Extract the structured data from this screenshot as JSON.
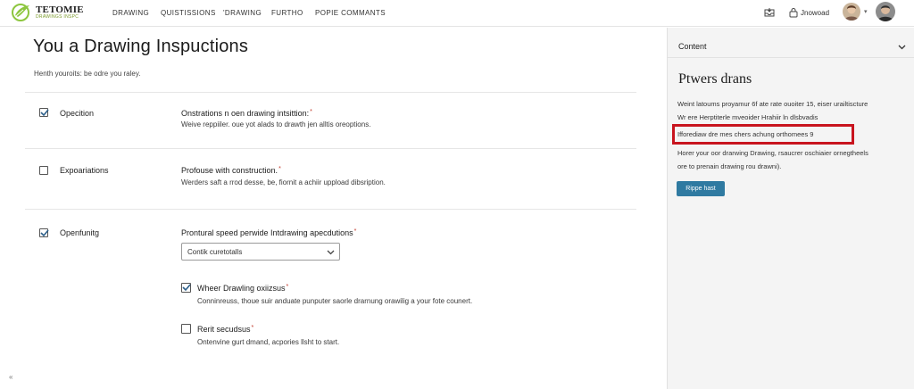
{
  "brand": {
    "name": "TETOMIE",
    "tagline": "DRAWINGS INSPC",
    "logo_color": "#8dc63f"
  },
  "nav": {
    "items": [
      "DRAWING",
      "QUISTISSIONS",
      "'DRAWING",
      "FURTHO",
      "POPIE COMMANTS"
    ],
    "user_label": "Jnowoad"
  },
  "main": {
    "title": "You a Drawing Inspuctions",
    "subtitle": "Henth youroits: be odre you raley.",
    "rows": [
      {
        "label": "Opecition",
        "checked": true,
        "question": "Onstrations n oen drawing intsittion:",
        "desc": "Weive reppiiler. oue yot alads to drawth jen alltis oreoptions."
      },
      {
        "label": "Expoariations",
        "checked": false,
        "question": "Profouse with construction.",
        "desc": "Werders saft a rrod desse, be, fiornit a achiir uppload dibsription."
      },
      {
        "label": "Openfunitg",
        "checked": true,
        "question": "Prontural speed perwide Intdrawing apecdutions",
        "select_value": "Contik curetotalls"
      }
    ],
    "sub_options": [
      {
        "title": "Wheer Drawling oxiizsus",
        "checked": true,
        "desc": "Conninreuss, thoue suir anduate punputer saorle drarnung orawilig a your fote counert."
      },
      {
        "title": "Rerit secudsus",
        "checked": false,
        "desc": "Ontenvine gurt dmand, acpories llsht to start."
      }
    ],
    "required_mark": "*",
    "bottom_icon": "«"
  },
  "panel": {
    "header": "Content",
    "title": "Ptwers drans",
    "lines": [
      "Weint latoums proyamur 6f ate rate ouoiter 15, eiser urailtiscture",
      "Wr ere Herptiterle mveoider Hrahiir ln dlsbvadis",
      "Ifforediaw dre mes chers achung orthomees",
      "Horer your oor drarwing Drawing, rsaucrer oschiaier ornegtheels",
      "ore to prenain drawing rou drawni)."
    ],
    "highlight_suffix": "9",
    "button_label": "Rippe hast",
    "highlight_color": "#c8141e",
    "button_color": "#2f7aa1"
  }
}
